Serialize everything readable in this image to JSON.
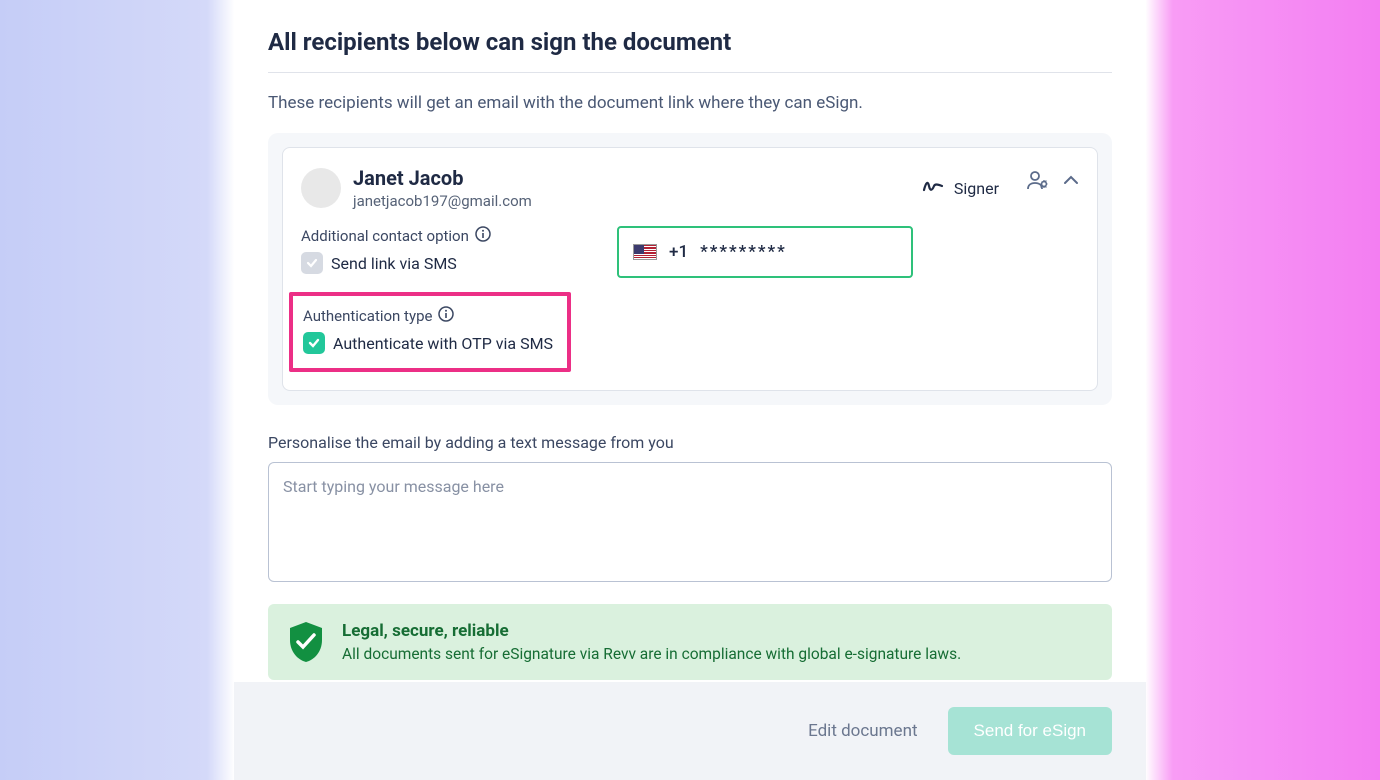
{
  "title": "All recipients below can sign the document",
  "subtitle": "These recipients will get an email with the document link where they can eSign.",
  "recipient": {
    "name": "Janet Jacob",
    "email": "janetjacob197@gmail.com",
    "role": "Signer",
    "additional_contact_label": "Additional contact option",
    "send_sms_label": "Send link via SMS",
    "phone_prefix": "+1",
    "phone_masked": "*********",
    "auth_type_label": "Authentication type",
    "auth_otp_label": "Authenticate with OTP via SMS"
  },
  "personalise_label": "Personalise the email by adding a text message from you",
  "message_placeholder": "Start typing your message here",
  "legal": {
    "title": "Legal, secure, reliable",
    "sub": "All documents sent for eSignature via Revv are in compliance with global e-signature laws."
  },
  "footer": {
    "edit": "Edit document",
    "send": "Send for eSign"
  }
}
